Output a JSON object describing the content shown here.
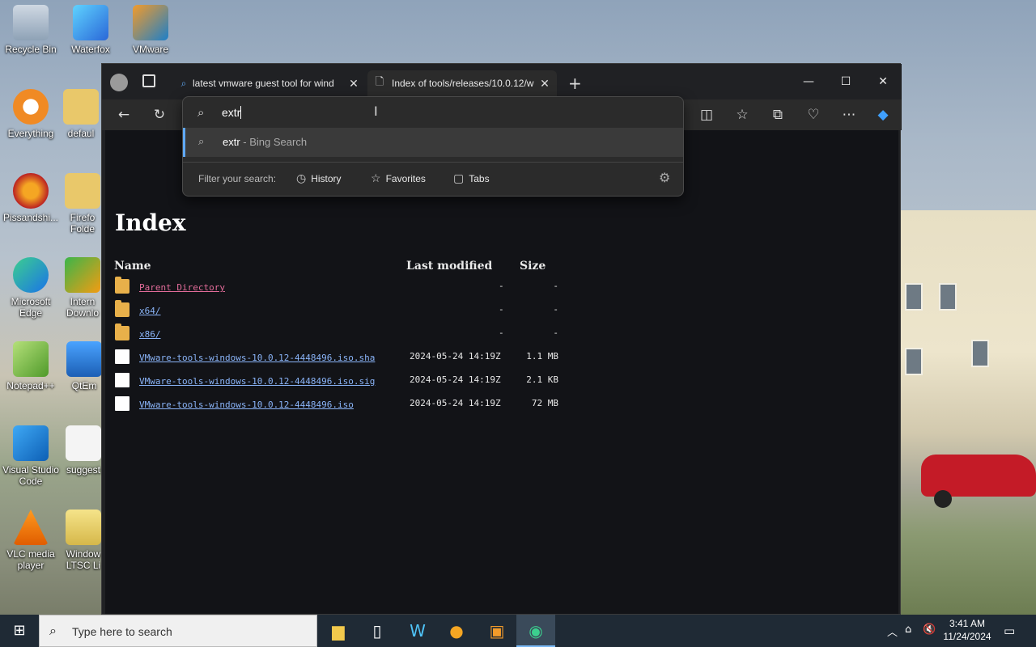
{
  "desktop": {
    "icons": [
      {
        "label": "Recycle Bin",
        "icon": "recycle-bin-icon"
      },
      {
        "label": "Waterfox",
        "icon": "waterfox-icon"
      },
      {
        "label": "VMware",
        "icon": "vmware-icon"
      },
      {
        "label": "Everything",
        "icon": "everything-icon"
      },
      {
        "label": "defaul",
        "icon": "folder-icon"
      },
      {
        "label": "Pissandshi...",
        "icon": "browser-icon"
      },
      {
        "label": "Firefo Folde",
        "icon": "folder-icon"
      },
      {
        "label": "Microsoft Edge",
        "icon": "edge-icon"
      },
      {
        "label": "Intern Downlo",
        "icon": "download-manager-icon"
      },
      {
        "label": "Notepad++",
        "icon": "notepad-plus-plus-icon"
      },
      {
        "label": "QtEm",
        "icon": "monitor-icon"
      },
      {
        "label": "Visual Studio Code",
        "icon": "vscode-icon"
      },
      {
        "label": "suggest",
        "icon": "document-icon"
      },
      {
        "label": "VLC media player",
        "icon": "vlc-icon"
      },
      {
        "label": "Window LTSC Li",
        "icon": "iso-icon"
      }
    ]
  },
  "browser": {
    "tabs": [
      {
        "title": "latest vmware guest tool for wind",
        "icon": "search-icon",
        "active": false
      },
      {
        "title": "Index of tools/releases/10.0.12/w",
        "icon": "page-icon",
        "active": true
      }
    ],
    "new_tab": "+",
    "window_controls": {
      "minimize": "—",
      "maximize": "☐",
      "close": "✕"
    },
    "omnibox": {
      "value": "extr",
      "suggestion": {
        "query": "extr",
        "suffix": " - Bing Search"
      },
      "filter_label": "Filter your search:",
      "filters": [
        "History",
        "Favorites",
        "Tabs"
      ]
    },
    "page": {
      "title": "Index",
      "columns": {
        "name": "Name",
        "modified": "Last modified",
        "size": "Size"
      },
      "rows": [
        {
          "name": "Parent Directory",
          "type": "folder",
          "modified": "",
          "size": "-",
          "dash": "-",
          "visited": true
        },
        {
          "name": "x64/",
          "type": "folder",
          "modified": "",
          "size": "-",
          "dash": "-",
          "visited": false
        },
        {
          "name": "x86/",
          "type": "folder",
          "modified": "",
          "size": "-",
          "dash": "-",
          "visited": false
        },
        {
          "name": "VMware-tools-windows-10.0.12-4448496.iso.sha",
          "type": "file",
          "modified": "2024-05-24 14:19Z",
          "size": "1.1 MB",
          "visited": false
        },
        {
          "name": "VMware-tools-windows-10.0.12-4448496.iso.sig",
          "type": "file",
          "modified": "2024-05-24 14:19Z",
          "size": "2.1 KB",
          "visited": false
        },
        {
          "name": "VMware-tools-windows-10.0.12-4448496.iso",
          "type": "file",
          "modified": "2024-05-24 14:19Z",
          "size": "72 MB",
          "visited": false
        }
      ]
    }
  },
  "taskbar": {
    "search_placeholder": "Type here to search",
    "apps": [
      "file-explorer-icon",
      "notepad-icon",
      "waterfox-icon",
      "browser-icon",
      "vmware-icon",
      "edge-icon"
    ],
    "clock": {
      "time": "3:41 AM",
      "date": "11/24/2024"
    }
  },
  "colors": {
    "link": "#8ab4f8",
    "visited": "#e26c9a",
    "accent": "#5fa8f5",
    "page_bg": "#121317"
  }
}
